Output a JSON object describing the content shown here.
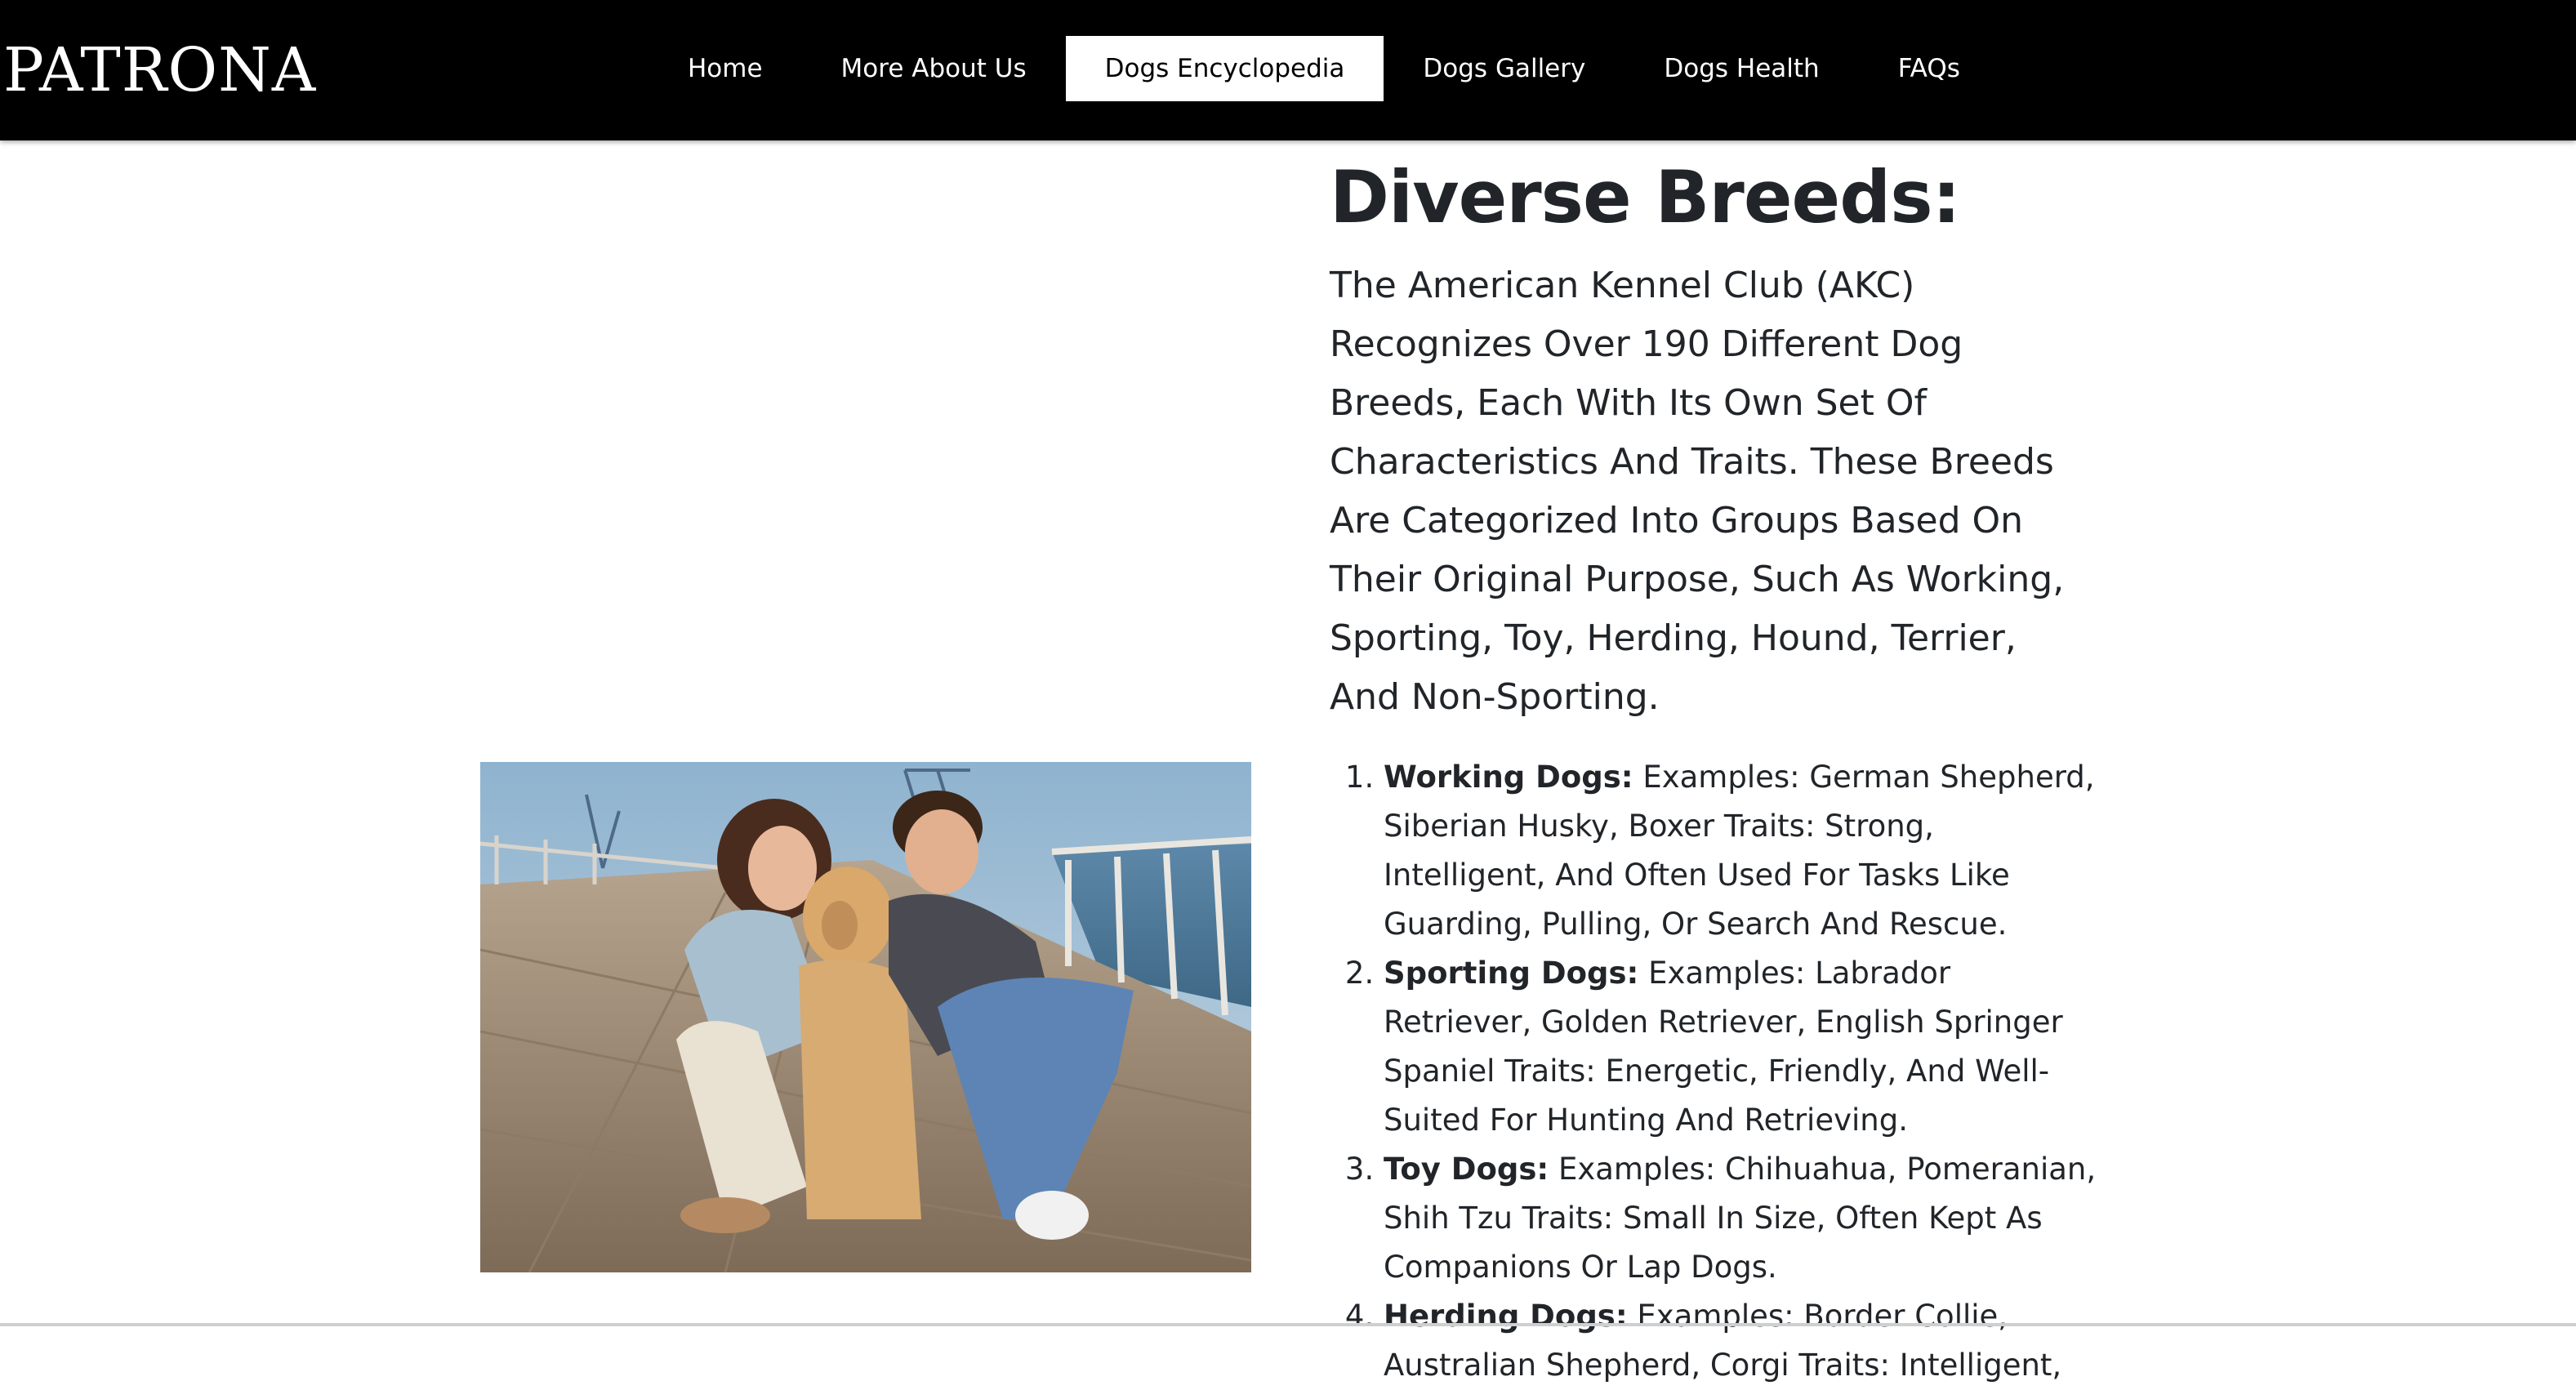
{
  "brand": {
    "name": "PATRONA"
  },
  "nav": {
    "items": [
      {
        "label": "Home",
        "active": false
      },
      {
        "label": "More About Us",
        "active": false
      },
      {
        "label": "Dogs Encyclopedia",
        "active": true
      },
      {
        "label": "Dogs Gallery",
        "active": false
      },
      {
        "label": "Dogs Health",
        "active": false
      },
      {
        "label": "FAQs",
        "active": false
      }
    ]
  },
  "main": {
    "heading": "Diverse Breeds:",
    "intro": "The American Kennel Club (AKC) Recognizes Over 190 Different Dog Breeds, Each With Its Own Set Of Characteristics And Traits. These Breeds Are Categorized Into Groups Based On Their Original Purpose, Such As Working, Sporting, Toy, Herding, Hound, Terrier, And Non-Sporting.",
    "breeds": [
      {
        "name": "Working Dogs:",
        "text": " Examples: German Shepherd, Siberian Husky, Boxer Traits: Strong, Intelligent, And Often Used For Tasks Like Guarding, Pulling, Or Search And Rescue."
      },
      {
        "name": "Sporting Dogs:",
        "text": " Examples: Labrador Retriever, Golden Retriever, English Springer Spaniel Traits: Energetic, Friendly, And Well-Suited For Hunting And Retrieving."
      },
      {
        "name": "Toy Dogs:",
        "text": " Examples: Chihuahua, Pomeranian, Shih Tzu Traits: Small In Size, Often Kept As Companions Or Lap Dogs."
      },
      {
        "name": "Herding Dogs:",
        "text": " Examples: Border Collie, Australian Shepherd, Corgi Traits: Intelligent,"
      }
    ]
  },
  "colors": {
    "navbar_bg": "#000000",
    "nav_text": "#ffffff",
    "nav_active_bg": "#ffffff",
    "body_text": "#212529"
  }
}
